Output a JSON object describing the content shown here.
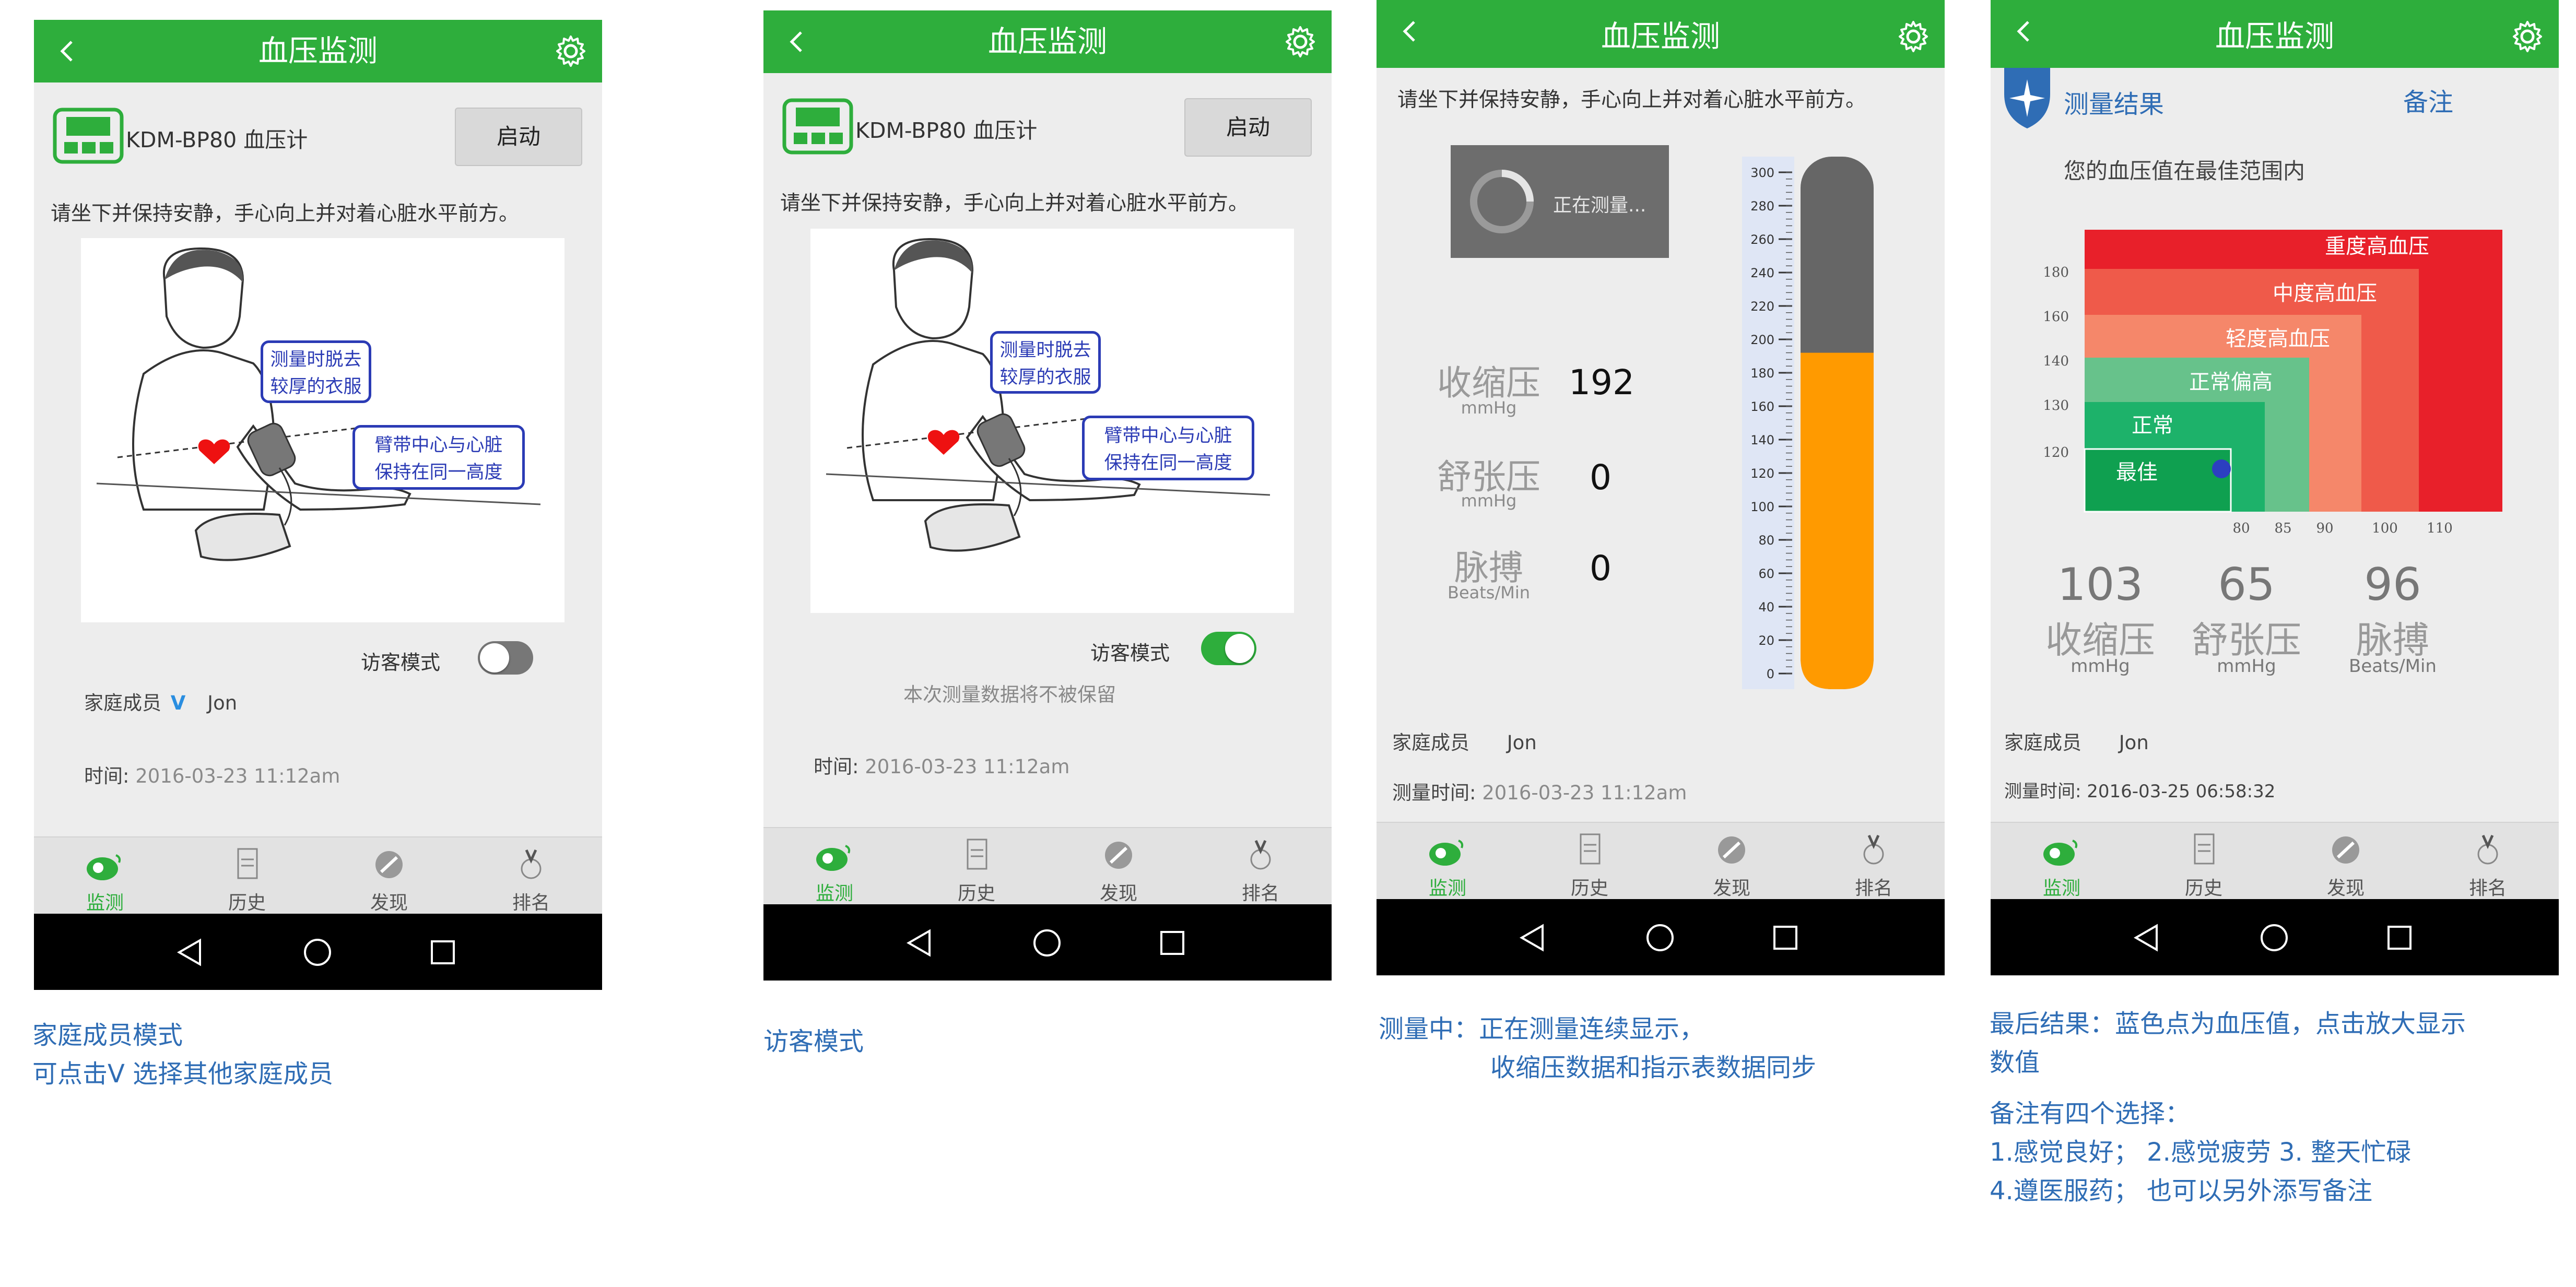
{
  "common": {
    "title": "血压监测",
    "tabs": [
      "监测",
      "历史",
      "发现",
      "排名"
    ],
    "member_label": "家庭成员",
    "member_name": "Jon"
  },
  "screen1": {
    "device_name": "KDM-BP80 血压计",
    "start_label": "启动",
    "instruction": "请坐下并保持安静，手心向上并对着心脏水平前方。",
    "bubble1": [
      "测量时脱去",
      "较厚的衣服"
    ],
    "bubble2": [
      "臂带中心与心脏",
      "保持在同一高度"
    ],
    "guest_label": "访客模式",
    "guest_on": false,
    "member_chevron": "V",
    "time_label": "时间: ",
    "time_value": "2016-03-23  11:12am"
  },
  "screen2": {
    "device_name": "KDM-BP80 血压计",
    "start_label": "启动",
    "instruction": "请坐下并保持安静，手心向上并对着心脏水平前方。",
    "bubble1": [
      "测量时脱去",
      "较厚的衣服"
    ],
    "bubble2": [
      "臂带中心与心脏",
      "保持在同一高度"
    ],
    "guest_label": "访客模式",
    "guest_on": true,
    "guest_note": "本次测量数据将不被保留",
    "time_label": "时间: ",
    "time_value": "2016-03-23  11:12am"
  },
  "screen3": {
    "instruction": "请坐下并保持安静，手心向上并对着心脏水平前方。",
    "measuring_text": "正在测量...",
    "systolic_label": "收缩压",
    "systolic_unit": "mmHg",
    "systolic_value": "192",
    "diastolic_label": "舒张压",
    "diastolic_unit": "mmHg",
    "diastolic_value": "0",
    "pulse_label": "脉搏",
    "pulse_unit": "Beats/Min",
    "pulse_value": "0",
    "gauge_max": 300,
    "gauge_level": 192,
    "gauge_ticks": [
      "300",
      "280",
      "260",
      "240",
      "220",
      "200",
      "180",
      "160",
      "140",
      "120",
      "100",
      "80",
      "60",
      "40",
      "20",
      "0"
    ],
    "time_label": "测量时间: ",
    "time_value": "2016-03-23  11:12am"
  },
  "screen4": {
    "result_title": "测量结果",
    "note_link": "备注",
    "summary": "您的血压值在最佳范围内",
    "zones": [
      "重度高血压",
      "中度高血压",
      "轻度高血压",
      "正常偏高",
      "正常",
      "最佳"
    ],
    "zone_colors": [
      "#e8202a",
      "#ef5a4a",
      "#f5876a",
      "#67c28b",
      "#1db26a",
      "#0fa050"
    ],
    "y_ticks": [
      "180",
      "160",
      "140",
      "130",
      "120"
    ],
    "x_ticks": [
      "80",
      "85",
      "90",
      "100",
      "110"
    ],
    "systolic_value": "103",
    "systolic_label": "收缩压",
    "systolic_unit": "mmHg",
    "diastolic_value": "65",
    "diastolic_label": "舒张压",
    "diastolic_unit": "mmHg",
    "pulse_value": "96",
    "pulse_label": "脉搏",
    "pulse_unit": "Beats/Min",
    "time_label": "测量时间: ",
    "time_value": "2016-03-25 06:58:32"
  },
  "captions": {
    "c1": [
      "家庭成员模式",
      "可点击V 选择其他家庭成员"
    ],
    "c2": [
      "访客模式"
    ],
    "c3": [
      "测量中：正在测量连续显示，",
      "收缩压数据和指示表数据同步"
    ],
    "c4a": [
      "最后结果：蓝色点为血压值，点击放大显示",
      "数值"
    ],
    "c4b": [
      "备注有四个选择：",
      "1.感觉良好； 2.感觉疲劳 3. 整天忙碌",
      "4.遵医服药； 也可以另外添写备注"
    ]
  },
  "colors": {
    "brand_green": "#2eae3c",
    "caption_blue": "#2f6db5",
    "bubble_blue": "#2b3bb5",
    "gauge_orange": "#ff9a00",
    "gauge_gray": "#666666"
  }
}
